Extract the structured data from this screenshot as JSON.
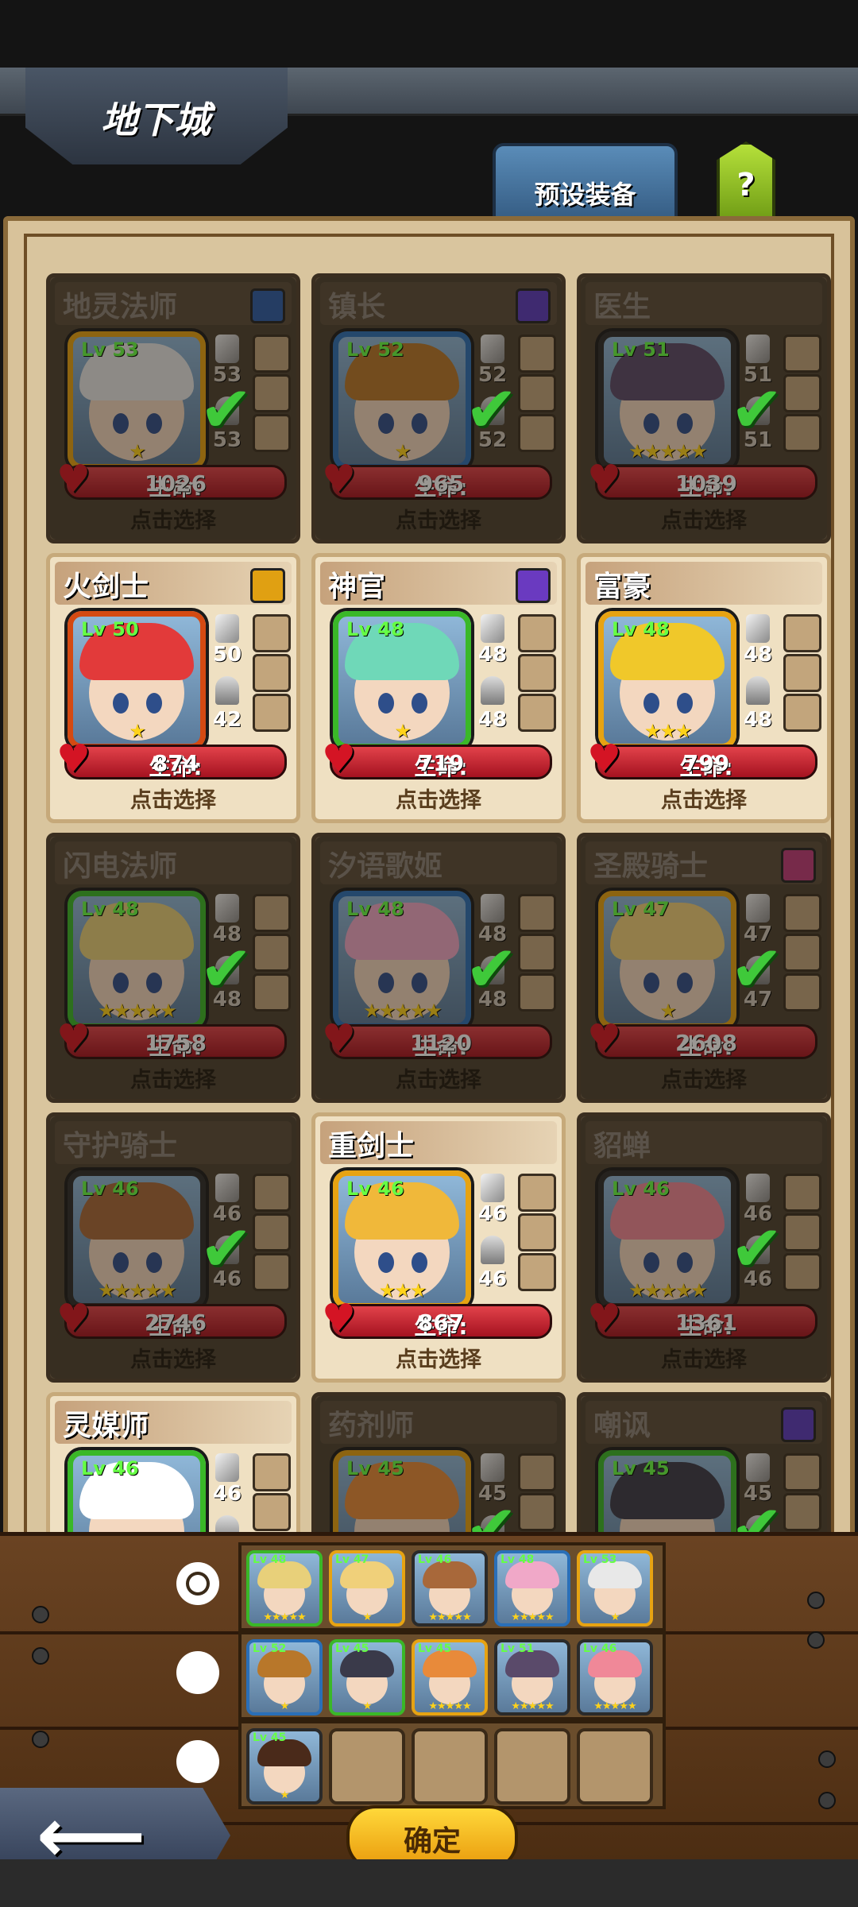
{
  "title": "地下城",
  "preset_label": "预设装备",
  "help_label": "?",
  "hp_prefix": "生命: ",
  "choose_label": "点击选择",
  "confirm_label": "确定",
  "heroes": [
    {
      "name": "地灵法师",
      "lv": "Lv 53",
      "atk": "53",
      "def": "53",
      "hp": "1026",
      "selected": true,
      "stars": "★",
      "hair": "#e8e8e8",
      "frame": "#e7a312",
      "gem": "#2a5ca8"
    },
    {
      "name": "镇长",
      "lv": "Lv 52",
      "atk": "52",
      "def": "52",
      "hp": "965",
      "selected": true,
      "stars": "★",
      "hair": "#b8772a",
      "frame": "#2a6fb8",
      "gem": "#5a3ac0"
    },
    {
      "name": "医生",
      "lv": "Lv 51",
      "atk": "51",
      "def": "51",
      "hp": "1039",
      "selected": true,
      "stars": "★★★★★",
      "hair": "#5a4a6a",
      "frame": "#2a2a2a",
      "gem": ""
    },
    {
      "name": "火剑士",
      "lv": "Lv 50",
      "atk": "50",
      "def": "42",
      "hp": "874",
      "selected": false,
      "stars": "★",
      "hair": "#e23a3a",
      "frame": "#d44a12",
      "gem": "#e0a012"
    },
    {
      "name": "神官",
      "lv": "Lv 48",
      "atk": "48",
      "def": "48",
      "hp": "719",
      "selected": false,
      "stars": "★",
      "hair": "#6fd8b8",
      "frame": "#3ab828",
      "gem": "#6a3ac0"
    },
    {
      "name": "富豪",
      "lv": "Lv 48",
      "atk": "48",
      "def": "48",
      "hp": "799",
      "selected": false,
      "stars": "★★★",
      "hair": "#f0c82a",
      "frame": "#e7a312",
      "gem": ""
    },
    {
      "name": "闪电法师",
      "lv": "Lv 48",
      "atk": "48",
      "def": "48",
      "hp": "1758",
      "selected": true,
      "stars": "★★★★★",
      "hair": "#e8d07a",
      "frame": "#3ab828",
      "gem": ""
    },
    {
      "name": "汐语歌姬",
      "lv": "Lv 48",
      "atk": "48",
      "def": "48",
      "hp": "1120",
      "selected": true,
      "stars": "★★★★★",
      "hair": "#f0a8c8",
      "frame": "#2a6fb8",
      "gem": ""
    },
    {
      "name": "圣殿骑士",
      "lv": "Lv 47",
      "atk": "47",
      "def": "47",
      "hp": "2608",
      "selected": true,
      "stars": "★",
      "hair": "#f0d07a",
      "frame": "#e7a312",
      "gem": "#c03a7a"
    },
    {
      "name": "守护骑士",
      "lv": "Lv 46",
      "atk": "46",
      "def": "46",
      "hp": "2746",
      "selected": true,
      "stars": "★★★★★",
      "hair": "#a8683a",
      "frame": "#2a2a2a",
      "gem": ""
    },
    {
      "name": "重剑士",
      "lv": "Lv 46",
      "atk": "46",
      "def": "46",
      "hp": "867",
      "selected": false,
      "stars": "★★★",
      "hair": "#f0b83a",
      "frame": "#e7a312",
      "gem": ""
    },
    {
      "name": "貂蝉",
      "lv": "Lv 46",
      "atk": "46",
      "def": "46",
      "hp": "1361",
      "selected": true,
      "stars": "★★★★★",
      "hair": "#f08898",
      "frame": "#2a2a2a",
      "gem": ""
    },
    {
      "name": "灵媒师",
      "lv": "Lv 46",
      "atk": "46",
      "def": "",
      "hp": "",
      "selected": false,
      "stars": "",
      "hair": "#ffffff",
      "frame": "#3ab828",
      "gem": ""
    },
    {
      "name": "药剂师",
      "lv": "Lv 45",
      "atk": "45",
      "def": "",
      "hp": "",
      "selected": true,
      "stars": "",
      "hair": "#e88a3a",
      "frame": "#e7a312",
      "gem": ""
    },
    {
      "name": "嘲讽",
      "lv": "Lv 45",
      "atk": "45",
      "def": "",
      "hp": "",
      "selected": true,
      "stars": "",
      "hair": "#3a3a4a",
      "frame": "#3ab828",
      "gem": "#5a3ac0"
    }
  ],
  "teams": [
    {
      "active": true,
      "members": [
        {
          "lv": "Lv 48",
          "hair": "#e8d07a",
          "frame": "#3ab828",
          "stars": "★★★★★"
        },
        {
          "lv": "Lv 47",
          "hair": "#f0d07a",
          "frame": "#e7a312",
          "stars": "★"
        },
        {
          "lv": "Lv 46",
          "hair": "#a8683a",
          "frame": "#2a2a2a",
          "stars": "★★★★★"
        },
        {
          "lv": "Lv 48",
          "hair": "#f0a8c8",
          "frame": "#2a6fb8",
          "stars": "★★★★★"
        },
        {
          "lv": "Lv 53",
          "hair": "#e8e8e8",
          "frame": "#e7a312",
          "stars": "★"
        }
      ]
    },
    {
      "active": false,
      "members": [
        {
          "lv": "Lv 52",
          "hair": "#b8772a",
          "frame": "#2a6fb8",
          "stars": "★"
        },
        {
          "lv": "Lv 45",
          "hair": "#3a3a4a",
          "frame": "#3ab828",
          "stars": "★"
        },
        {
          "lv": "Lv 45",
          "hair": "#e88a3a",
          "frame": "#e7a312",
          "stars": "★★★★★"
        },
        {
          "lv": "Lv 51",
          "hair": "#5a4a6a",
          "frame": "#2a2a2a",
          "stars": "★★★★★"
        },
        {
          "lv": "Lv 46",
          "hair": "#f08898",
          "frame": "#2a2a2a",
          "stars": "★★★★★"
        }
      ]
    },
    {
      "active": false,
      "members": [
        {
          "lv": "Lv 45",
          "hair": "#4a2a1a",
          "frame": "#2a2a2a",
          "stars": "★"
        },
        null,
        null,
        null,
        null
      ]
    }
  ]
}
